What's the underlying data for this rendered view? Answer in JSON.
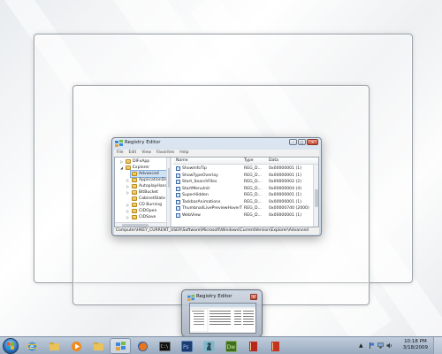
{
  "regedit": {
    "title": "Registry Editor",
    "menu": [
      "File",
      "Edit",
      "View",
      "Favorites",
      "Help"
    ],
    "tree_items": [
      "DIFxApp",
      "Explorer",
      "Advanced",
      "ApplicationDest",
      "AutoplayHandle",
      "BitBucket",
      "CabinetState",
      "CD Burning",
      "CIDOpen",
      "CIDSave"
    ],
    "columns": {
      "name": "Name",
      "type": "Type",
      "data": "Data"
    },
    "values": [
      {
        "name": "ShowInfoTip",
        "type": "REG_D...",
        "data": "0x00000001 (1)"
      },
      {
        "name": "ShowTypeOverlay",
        "type": "REG_D...",
        "data": "0x00000001 (1)"
      },
      {
        "name": "Start_SearchFiles",
        "type": "REG_D...",
        "data": "0x00000002 (2)"
      },
      {
        "name": "StartMenuInit",
        "type": "REG_D...",
        "data": "0x00000004 (4)"
      },
      {
        "name": "SuperHidden",
        "type": "REG_D...",
        "data": "0x00000001 (1)"
      },
      {
        "name": "TaskbarAnimations",
        "type": "REG_D...",
        "data": "0x00000001 (1)"
      },
      {
        "name": "ThumbnailLivePreviewHoverTime",
        "type": "REG_D...",
        "data": "0x000007d0 (2000)"
      },
      {
        "name": "WebView",
        "type": "REG_D...",
        "data": "0x00000001 (1)"
      }
    ],
    "status_path": "Computer\\HKEY_CURRENT_USER\\Software\\Microsoft\\Windows\\CurrentVersion\\Explorer\\Advanced"
  },
  "thumbnail": {
    "title": "Registry Editor"
  },
  "taskbar": {
    "pinned": [
      "internet-explorer-icon",
      "windows-explorer-icon",
      "media-player-icon",
      "windows-explorer-icon",
      "registry-editor-icon",
      "firefox-icon",
      "command-prompt-icon",
      "photoshop-icon",
      "chess-icon",
      "dreamweaver-icon",
      "book-icon"
    ],
    "active_index": 4,
    "clock_time": "10:18 PM",
    "clock_date": "3/18/2009"
  }
}
